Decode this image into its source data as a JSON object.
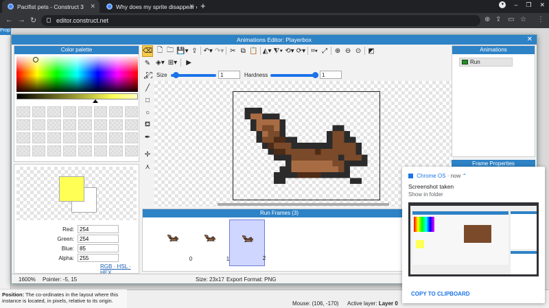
{
  "browser": {
    "tabs": [
      {
        "title": "Pacifist pets - Construct 3",
        "active": true
      },
      {
        "title": "Why does my sprite disappear c",
        "active": false
      }
    ],
    "new_tab": "+",
    "url": "editor.construct.net",
    "window_buttons": [
      "–",
      "❐",
      "✕"
    ]
  },
  "background_app": {
    "left_panel_title": "Prop",
    "help_label": "Position:",
    "help_text": "The co-ordinates in the layout where this instance is located, in pixels, relative to its origin.",
    "mouse": "Mouse: (106, -170)",
    "active_layer_label": "Active layer:",
    "active_layer_value": "Layer 0"
  },
  "dialog": {
    "title": "Animations Editor: Playerbox",
    "close": "✕"
  },
  "palette": {
    "title": "Color palette",
    "swatch_count": 32
  },
  "color": {
    "primary": "#ffff55",
    "secondary": "#ffffff",
    "red_label": "Red:",
    "red": "254",
    "green_label": "Green:",
    "green": "254",
    "blue_label": "Blue:",
    "blue": "85",
    "alpha_label": "Alpha:",
    "alpha": "255",
    "formats": [
      "RGB",
      "HSL",
      "HEX"
    ]
  },
  "brush": {
    "size_label": "Size",
    "size_value": "1",
    "size_level": 0.05,
    "hardness_label": "Hardness",
    "hardness_value": "1",
    "hardness_level": 1.0
  },
  "frames": {
    "title": "Run Frames (3)",
    "items": [
      {
        "num": "0",
        "selected": false
      },
      {
        "num": "1",
        "selected": false
      },
      {
        "num": "2",
        "selected": true
      }
    ]
  },
  "animations": {
    "title": "Animations",
    "items": [
      "Run"
    ],
    "frame_props_title": "Frame Properties"
  },
  "status": {
    "zoom": "1600%",
    "pointer": "Pointer: -5, 15",
    "size": "Size: 23x17",
    "export": "Export Format: PNG"
  },
  "notification": {
    "source": "Chrome OS",
    "time": "now",
    "title": "Screenshot taken",
    "subtitle": "Show in folder",
    "action": "COPY TO CLIPBOARD"
  },
  "colors": {
    "accent": "#2e82c6",
    "sprite_dark": "#2b2b2b",
    "sprite_mid": "#7a4a2a",
    "sprite_light": "#a86c44",
    "sprite_shadow": "#4e2c16"
  }
}
